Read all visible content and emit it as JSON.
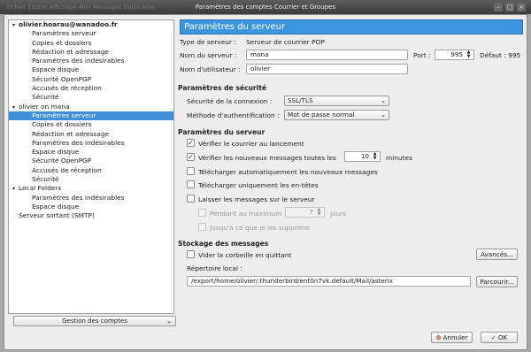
{
  "window": {
    "title": "Paramètres des comptes Courrier et Groupes",
    "background_menu_ghost": "Fichier  Édition  Affichage  Aller  Messages  Outils  Aide"
  },
  "accounts_tree": [
    {
      "label": "olivier.hoarau@wanadoo.fr",
      "level": 0,
      "expanded": true,
      "bold": true,
      "selected": false
    },
    {
      "label": "Paramètres serveur",
      "level": 1,
      "selected": false
    },
    {
      "label": "Copies et dossiers",
      "level": 1,
      "selected": false
    },
    {
      "label": "Rédaction et adressage",
      "level": 1,
      "selected": false
    },
    {
      "label": "Paramètres des indésirables",
      "level": 1,
      "selected": false
    },
    {
      "label": "Espace disque",
      "level": 1,
      "selected": false
    },
    {
      "label": "Sécurité OpenPGP",
      "level": 1,
      "selected": false
    },
    {
      "label": "Accusés de réception",
      "level": 1,
      "selected": false
    },
    {
      "label": "Sécurité",
      "level": 1,
      "selected": false
    },
    {
      "label": "olivier on mana",
      "level": 0,
      "expanded": true,
      "bold": false,
      "selected": false
    },
    {
      "label": "Paramètres serveur",
      "level": 1,
      "selected": true
    },
    {
      "label": "Copies et dossiers",
      "level": 1,
      "selected": false
    },
    {
      "label": "Rédaction et adressage",
      "level": 1,
      "selected": false
    },
    {
      "label": "Paramètres des indésirables",
      "level": 1,
      "selected": false
    },
    {
      "label": "Espace disque",
      "level": 1,
      "selected": false
    },
    {
      "label": "Sécurité OpenPGP",
      "level": 1,
      "selected": false
    },
    {
      "label": "Accusés de réception",
      "level": 1,
      "selected": false
    },
    {
      "label": "Sécurité",
      "level": 1,
      "selected": false
    },
    {
      "label": "Local Folders",
      "level": 0,
      "expanded": true,
      "bold": false,
      "selected": false
    },
    {
      "label": "Paramètres des indésirables",
      "level": 1,
      "selected": false
    },
    {
      "label": "Espace disque",
      "level": 1,
      "selected": false
    },
    {
      "label": "Serveur sortant (SMTP)",
      "level": 0,
      "expanded": false,
      "leaf": true,
      "bold": false,
      "selected": false
    }
  ],
  "manage_accounts_label": "Gestion des comptes",
  "main": {
    "header": "Paramètres du serveur",
    "server_type_label": "Type de serveur :",
    "server_type_value": "Serveur de courrier POP",
    "server_name_label": "Nom du serveur :",
    "server_name_value": "mana",
    "port_label": "Port :",
    "port_value": "995",
    "default_label": "Défaut : 995",
    "username_label": "Nom d'utilisateur :",
    "username_value": "olivier"
  },
  "security": {
    "title": "Paramètres de sécurité",
    "connection_label": "Sécurité de la connexion :",
    "connection_value": "SSL/TLS",
    "auth_label": "Méthode d'authentification :",
    "auth_value": "Mot de passe normal"
  },
  "server_settings": {
    "title": "Paramètres du serveur",
    "check_on_startup": {
      "label": "Vérifier le courrier au lancement",
      "checked": true
    },
    "check_every": {
      "label": "Vérifier les nouveaux messages toutes les",
      "checked": true,
      "value": "10",
      "unit": "minutes"
    },
    "auto_download": {
      "label": "Télécharger automatiquement les nouveaux messages",
      "checked": false
    },
    "headers_only": {
      "label": "Télécharger uniquement les en-têtes",
      "checked": false
    },
    "leave_on_server": {
      "label": "Laisser les messages sur le serveur",
      "checked": false
    },
    "for_at_most": {
      "label": "Pendant au maximum",
      "checked": false,
      "value": "7",
      "unit": "jours",
      "disabled": true
    },
    "until_deleted": {
      "label": "Jusqu'à ce que je les supprime",
      "checked": false,
      "disabled": true
    }
  },
  "storage": {
    "title": "Stockage des messages",
    "empty_trash": {
      "label": "Vider la corbeille en quittant",
      "checked": false
    },
    "advanced_label": "Avancés...",
    "local_dir_label": "Répertoire local :",
    "local_dir_value": "/export/home/olivier/.thunderbird/ent0n7vk.default/Mail/asterix",
    "browse_label": "Parcourir..."
  },
  "footer": {
    "cancel_label": "Annuler",
    "ok_label": "OK"
  }
}
